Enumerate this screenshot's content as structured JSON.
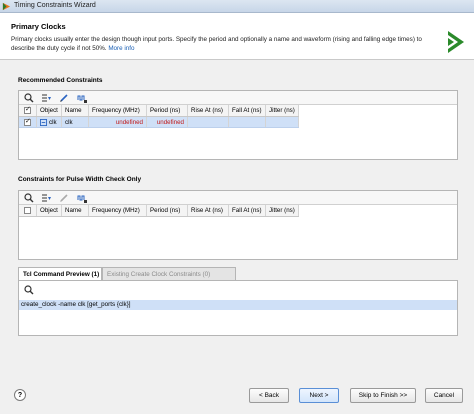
{
  "window": {
    "title": "Timing Constraints Wizard"
  },
  "header": {
    "title": "Primary Clocks",
    "description": "Primary clocks usually enter the design though input ports. Specify the period and optionally a name and waveform (rising and falling edge times) to describe the duty cycle if not 50%.",
    "more_info": "More info"
  },
  "recommended": {
    "label": "Recommended Constraints",
    "columns": [
      "",
      "Object",
      "Name",
      "Frequency (MHz)",
      "Period (ns)",
      "Rise At (ns)",
      "Fall At (ns)",
      "Jitter (ns)"
    ],
    "rows": [
      {
        "checked": true,
        "object": "clk",
        "name": "clk",
        "frequency": "undefined",
        "period": "undefined",
        "rise": "",
        "fall": "",
        "jitter": ""
      }
    ]
  },
  "pulse_width": {
    "label": "Constraints for Pulse Width Check Only",
    "columns": [
      "",
      "Object",
      "Name",
      "Frequency (MHz)",
      "Period (ns)",
      "Rise At (ns)",
      "Fall At (ns)",
      "Jitter (ns)"
    ]
  },
  "tabs": [
    {
      "label": "Tcl Command Preview (1)",
      "active": true
    },
    {
      "label": "Existing Create Clock Constraints (0)",
      "active": false
    }
  ],
  "tcl": {
    "command": "create_clock -name clk [get_ports {clk}]"
  },
  "footer": {
    "help": "?",
    "back": "< Back",
    "next": "Next >",
    "skip": "Skip to Finish >>",
    "cancel": "Cancel"
  },
  "icons": [
    "search-icon",
    "filter-icon",
    "edit-icon",
    "clock-add-icon",
    "help-icon",
    "vivado-logo-icon"
  ],
  "colors": {
    "selection": "#cfe0f7",
    "undefined_text": "#c01818",
    "link": "#1a5fb4"
  }
}
